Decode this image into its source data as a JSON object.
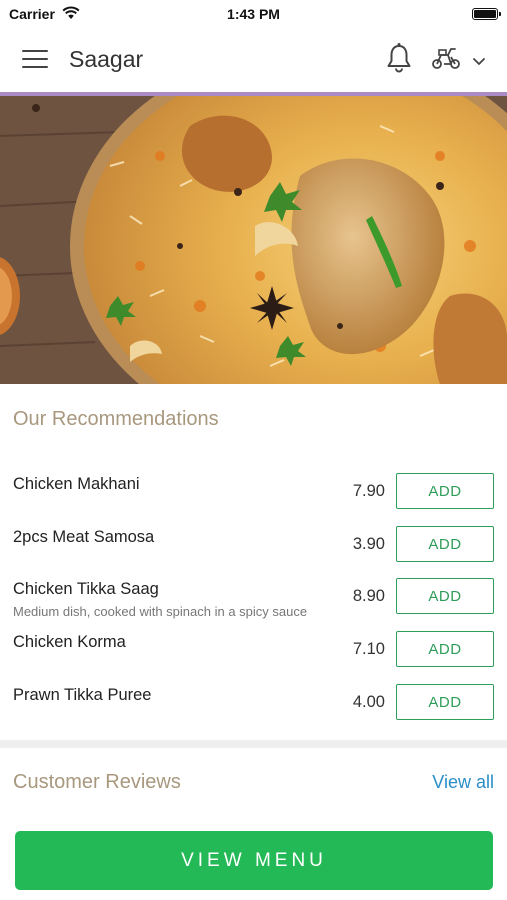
{
  "status_bar": {
    "carrier": "Carrier",
    "time": "1:43 PM",
    "wifi_icon": "wifi-icon",
    "battery_icon": "battery-icon"
  },
  "navbar": {
    "title": "Saagar",
    "menu_icon": "hamburger-menu-icon",
    "notification_icon": "bell-icon",
    "delivery_icon": "scooter-icon",
    "dropdown_icon": "chevron-down-icon",
    "accent_line_color": "#a98bc6"
  },
  "hero": {
    "image_subject": "chicken biryani dish"
  },
  "recommendations": {
    "title": "Our Recommendations",
    "add_label": "ADD",
    "items": [
      {
        "name": "Chicken Makhani",
        "description": "",
        "price": "7.90"
      },
      {
        "name": "2pcs Meat Samosa",
        "description": "",
        "price": "3.90"
      },
      {
        "name": "Chicken Tikka Saag",
        "description": "Medium dish, cooked with spinach in a spicy sauce",
        "price": "8.90"
      },
      {
        "name": "Chicken Korma",
        "description": "",
        "price": "7.10"
      },
      {
        "name": "Prawn Tikka Puree",
        "description": "",
        "price": "4.00"
      }
    ]
  },
  "reviews": {
    "title": "Customer Reviews",
    "view_all_label": "View all"
  },
  "footer": {
    "view_menu_label": "VIEW MENU"
  },
  "colors": {
    "primary_green": "#22b956",
    "add_button_green": "#2e9d59",
    "section_title": "#a8987e",
    "link_blue": "#2a8ec8"
  }
}
